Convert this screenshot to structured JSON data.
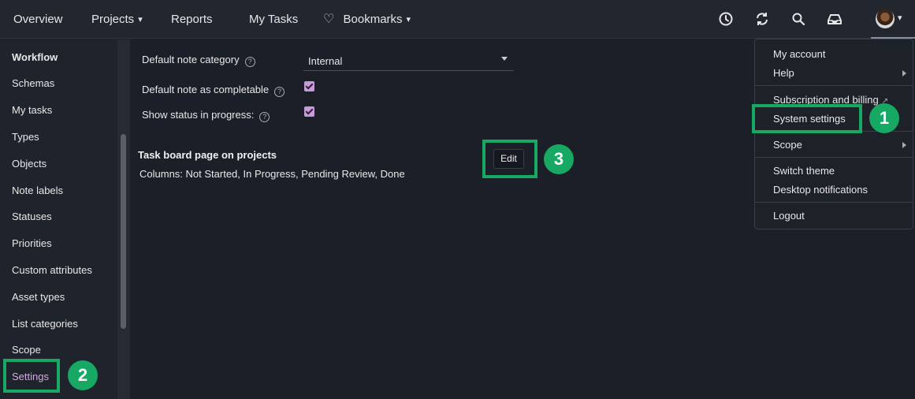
{
  "nav": {
    "overview": "Overview",
    "projects": "Projects",
    "reports": "Reports",
    "my_tasks": "My Tasks",
    "bookmarks": "Bookmarks"
  },
  "sidebar": {
    "heading": "Workflow",
    "items": [
      "Schemas",
      "My tasks",
      "Types",
      "Objects",
      "Note labels",
      "Statuses",
      "Priorities",
      "Custom attributes",
      "Asset types",
      "List categories",
      "Scope",
      "Settings"
    ]
  },
  "settings": {
    "default_note_category_label": "Default note category",
    "default_note_category_value": "Internal",
    "default_note_completable_label": "Default note as completable",
    "show_status_label": "Show status in progress:",
    "task_board_title": "Task board page on projects",
    "columns_text": "Columns: Not Started, In Progress, Pending Review, Done",
    "edit_label": "Edit"
  },
  "menu": {
    "my_account": "My account",
    "help": "Help",
    "subscription": "Subscription and billing",
    "system_settings": "System settings",
    "scope": "Scope",
    "switch_theme": "Switch theme",
    "desktop_notifications": "Desktop notifications",
    "logout": "Logout"
  },
  "badges": {
    "one": "1",
    "two": "2",
    "three": "3"
  },
  "colors": {
    "highlight": "#17a864",
    "checkbox": "#c79bd9",
    "active_sidebar": "#d6a6e6",
    "background": "#1b1f27"
  }
}
